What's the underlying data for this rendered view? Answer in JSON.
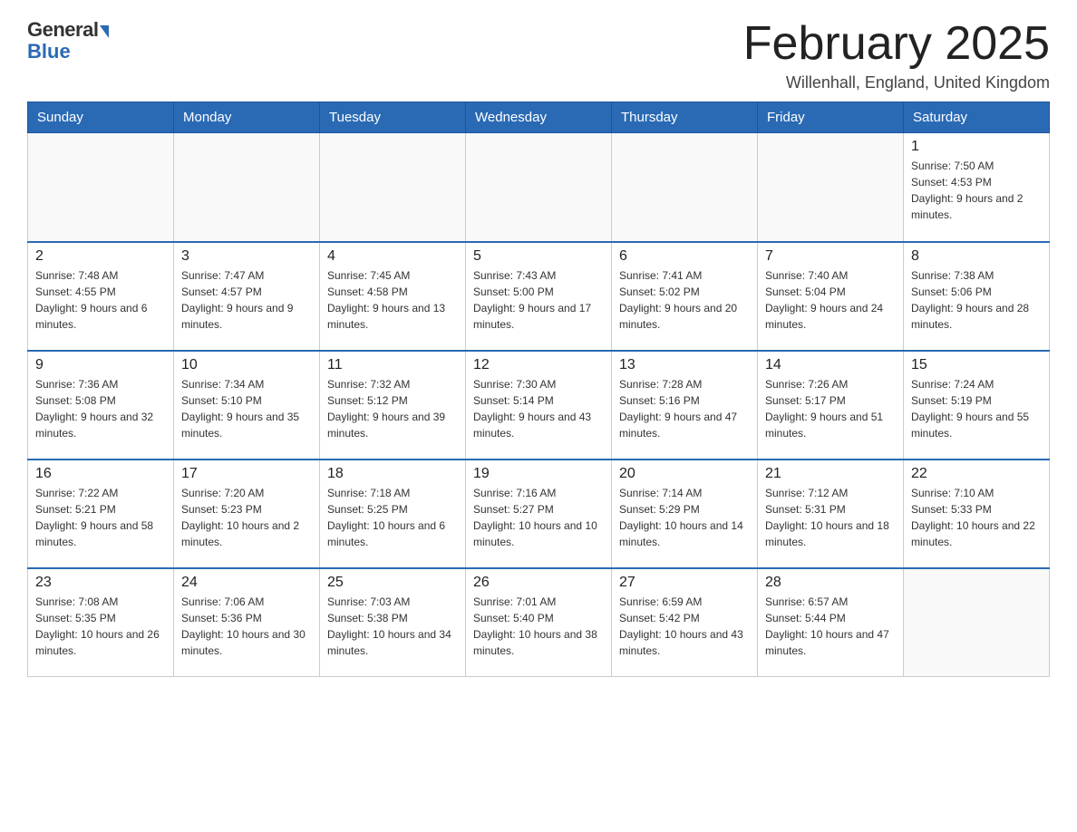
{
  "logo": {
    "general": "General",
    "blue": "Blue"
  },
  "header": {
    "title": "February 2025",
    "location": "Willenhall, England, United Kingdom"
  },
  "weekdays": [
    "Sunday",
    "Monday",
    "Tuesday",
    "Wednesday",
    "Thursday",
    "Friday",
    "Saturday"
  ],
  "weeks": [
    [
      {
        "day": "",
        "info": ""
      },
      {
        "day": "",
        "info": ""
      },
      {
        "day": "",
        "info": ""
      },
      {
        "day": "",
        "info": ""
      },
      {
        "day": "",
        "info": ""
      },
      {
        "day": "",
        "info": ""
      },
      {
        "day": "1",
        "info": "Sunrise: 7:50 AM\nSunset: 4:53 PM\nDaylight: 9 hours and 2 minutes."
      }
    ],
    [
      {
        "day": "2",
        "info": "Sunrise: 7:48 AM\nSunset: 4:55 PM\nDaylight: 9 hours and 6 minutes."
      },
      {
        "day": "3",
        "info": "Sunrise: 7:47 AM\nSunset: 4:57 PM\nDaylight: 9 hours and 9 minutes."
      },
      {
        "day": "4",
        "info": "Sunrise: 7:45 AM\nSunset: 4:58 PM\nDaylight: 9 hours and 13 minutes."
      },
      {
        "day": "5",
        "info": "Sunrise: 7:43 AM\nSunset: 5:00 PM\nDaylight: 9 hours and 17 minutes."
      },
      {
        "day": "6",
        "info": "Sunrise: 7:41 AM\nSunset: 5:02 PM\nDaylight: 9 hours and 20 minutes."
      },
      {
        "day": "7",
        "info": "Sunrise: 7:40 AM\nSunset: 5:04 PM\nDaylight: 9 hours and 24 minutes."
      },
      {
        "day": "8",
        "info": "Sunrise: 7:38 AM\nSunset: 5:06 PM\nDaylight: 9 hours and 28 minutes."
      }
    ],
    [
      {
        "day": "9",
        "info": "Sunrise: 7:36 AM\nSunset: 5:08 PM\nDaylight: 9 hours and 32 minutes."
      },
      {
        "day": "10",
        "info": "Sunrise: 7:34 AM\nSunset: 5:10 PM\nDaylight: 9 hours and 35 minutes."
      },
      {
        "day": "11",
        "info": "Sunrise: 7:32 AM\nSunset: 5:12 PM\nDaylight: 9 hours and 39 minutes."
      },
      {
        "day": "12",
        "info": "Sunrise: 7:30 AM\nSunset: 5:14 PM\nDaylight: 9 hours and 43 minutes."
      },
      {
        "day": "13",
        "info": "Sunrise: 7:28 AM\nSunset: 5:16 PM\nDaylight: 9 hours and 47 minutes."
      },
      {
        "day": "14",
        "info": "Sunrise: 7:26 AM\nSunset: 5:17 PM\nDaylight: 9 hours and 51 minutes."
      },
      {
        "day": "15",
        "info": "Sunrise: 7:24 AM\nSunset: 5:19 PM\nDaylight: 9 hours and 55 minutes."
      }
    ],
    [
      {
        "day": "16",
        "info": "Sunrise: 7:22 AM\nSunset: 5:21 PM\nDaylight: 9 hours and 58 minutes."
      },
      {
        "day": "17",
        "info": "Sunrise: 7:20 AM\nSunset: 5:23 PM\nDaylight: 10 hours and 2 minutes."
      },
      {
        "day": "18",
        "info": "Sunrise: 7:18 AM\nSunset: 5:25 PM\nDaylight: 10 hours and 6 minutes."
      },
      {
        "day": "19",
        "info": "Sunrise: 7:16 AM\nSunset: 5:27 PM\nDaylight: 10 hours and 10 minutes."
      },
      {
        "day": "20",
        "info": "Sunrise: 7:14 AM\nSunset: 5:29 PM\nDaylight: 10 hours and 14 minutes."
      },
      {
        "day": "21",
        "info": "Sunrise: 7:12 AM\nSunset: 5:31 PM\nDaylight: 10 hours and 18 minutes."
      },
      {
        "day": "22",
        "info": "Sunrise: 7:10 AM\nSunset: 5:33 PM\nDaylight: 10 hours and 22 minutes."
      }
    ],
    [
      {
        "day": "23",
        "info": "Sunrise: 7:08 AM\nSunset: 5:35 PM\nDaylight: 10 hours and 26 minutes."
      },
      {
        "day": "24",
        "info": "Sunrise: 7:06 AM\nSunset: 5:36 PM\nDaylight: 10 hours and 30 minutes."
      },
      {
        "day": "25",
        "info": "Sunrise: 7:03 AM\nSunset: 5:38 PM\nDaylight: 10 hours and 34 minutes."
      },
      {
        "day": "26",
        "info": "Sunrise: 7:01 AM\nSunset: 5:40 PM\nDaylight: 10 hours and 38 minutes."
      },
      {
        "day": "27",
        "info": "Sunrise: 6:59 AM\nSunset: 5:42 PM\nDaylight: 10 hours and 43 minutes."
      },
      {
        "day": "28",
        "info": "Sunrise: 6:57 AM\nSunset: 5:44 PM\nDaylight: 10 hours and 47 minutes."
      },
      {
        "day": "",
        "info": ""
      }
    ]
  ]
}
